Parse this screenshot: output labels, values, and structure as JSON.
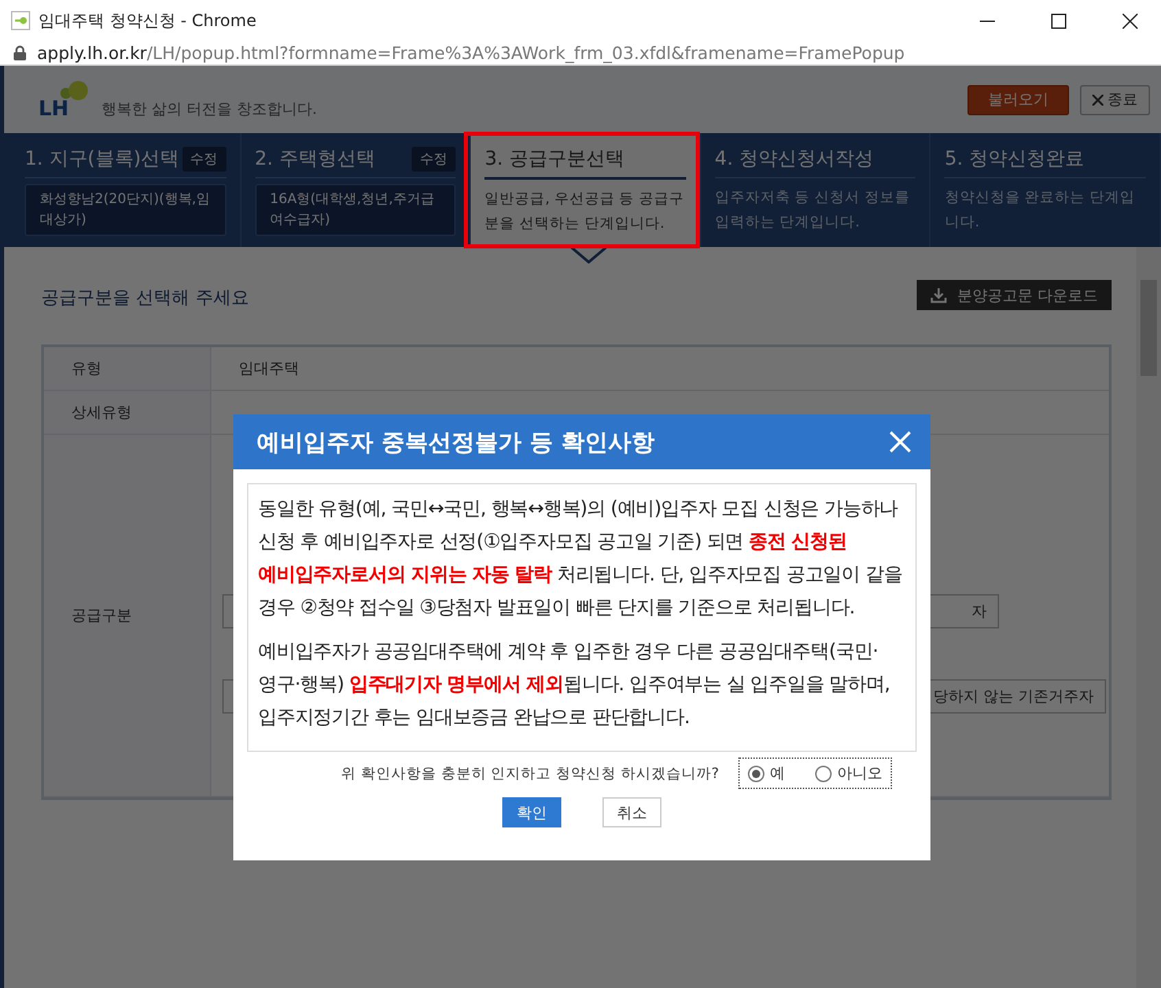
{
  "browser": {
    "title": "임대주택 청약신청 - Chrome",
    "url_domain": "apply.lh.or.kr",
    "url_path": "/LH/popup.html?formname=Frame%3A%3AWork_frm_03.xfdl&framename=FramePopup"
  },
  "header": {
    "logo": "LH",
    "slogan": "행복한 삶의 터전을 창조합니다.",
    "buttons": [
      {
        "label": "불러오기",
        "kind": "primary"
      },
      {
        "label": "종료",
        "kind": "close"
      }
    ]
  },
  "steps": [
    {
      "title": "1. 지구(블록)선택",
      "kind": "done",
      "edit_label": "수정",
      "summary": "화성향남2(20단지)(행복,임대상가)",
      "selected": false,
      "highlighted": false
    },
    {
      "title": "2. 주택형선택",
      "kind": "done",
      "edit_label": "수정",
      "summary": "16A형(대학생,청년,주거급여수급자)",
      "selected": false,
      "highlighted": false
    },
    {
      "title": "3. 공급구분선택",
      "kind": "todo",
      "description": "일반공급, 우선공급 등 공급구분을 선택하는 단계입니다.",
      "selected": true,
      "highlighted": true
    },
    {
      "title": "4. 청약신청서작성",
      "kind": "todo",
      "description": "입주자저축 등 신청서 정보를 입력하는 단계입니다.",
      "selected": false,
      "highlighted": false
    },
    {
      "title": "5. 청약신청완료",
      "kind": "todo",
      "description": "청약신청을 완료하는 단계입니다.",
      "selected": false,
      "highlighted": false
    }
  ],
  "content": {
    "title": "공급구분을 선택해 주세요",
    "download_button": "분양공고문 다운로드",
    "rows": [
      {
        "label": "유형",
        "value": "임대주택"
      },
      {
        "label": "상세유형"
      },
      {
        "label": "공급구분",
        "options": [
          "자",
          "당하지 않는 기존거주자"
        ]
      }
    ]
  },
  "dialog": {
    "title": "예비입주자 중복선정불가 등 확인사항",
    "paragraphs": [
      "동일한 유형(예, 국민↔국민, 행복↔행복)의 (예비)입주자 모집 신청은 가능하나 신청 후 예비입주자로 선정(①입주자모집 공고일 기준) 되면 **종전 신청된 예비입주자로서의 지위는 자동 탈락** 처리됩니다. 단, 입주자모집 공고일이 같을 경우 ②청약 접수일 ③당첨자 발표일이 빠른 단지를 기준으로 처리됩니다.",
      "예비입주자가 공공임대주택에 계약 후 입주한 경우 다른 공공임대주택(국민·영구·행복) **입주대기자 명부에서 제외**됩니다. 입주여부는 실 입주일을 말하며, 입주지정기간 후는 임대보증금 완납으로 판단합니다."
    ],
    "question": "위 확인사항을 충분히 인지하고 청약신청 하시겠습니까?",
    "options": [
      {
        "label": "예",
        "selected": true
      },
      {
        "label": "아니오",
        "selected": false
      }
    ],
    "buttons": [
      {
        "label": "확인",
        "kind": "primary"
      },
      {
        "label": "취소",
        "kind": "secondary"
      }
    ]
  }
}
